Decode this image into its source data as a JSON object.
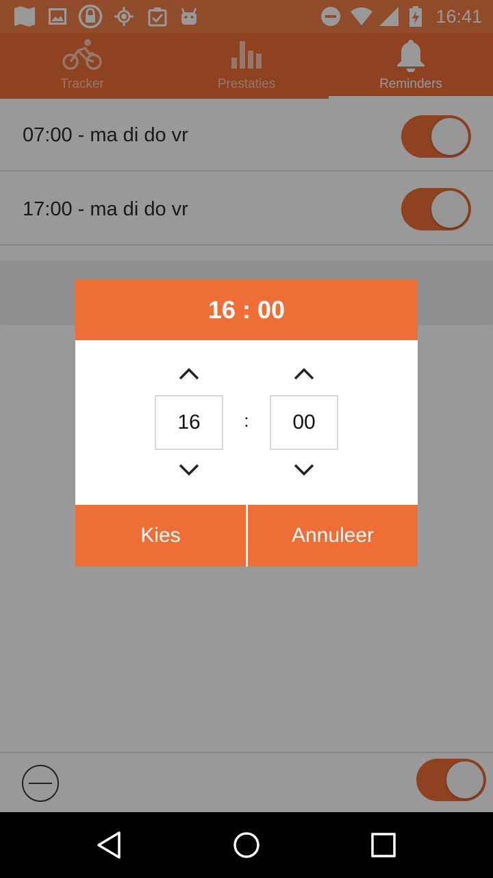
{
  "status_bar": {
    "time": "16:41",
    "icons_left": [
      "map-icon",
      "image-icon",
      "lock-icon",
      "location-icon",
      "clipboard-check-icon",
      "android-icon"
    ],
    "icons_right": [
      "do-not-disturb-icon",
      "wifi-icon",
      "signal-icon",
      "battery-charging-icon"
    ]
  },
  "tabs": [
    {
      "label": "Tracker",
      "icon": "bike-icon",
      "active": false
    },
    {
      "label": "Prestaties",
      "icon": "bar-chart-icon",
      "active": false
    },
    {
      "label": "Reminders",
      "icon": "bell-icon",
      "active": true
    }
  ],
  "reminders": [
    {
      "label": "07:00 - ma di do vr",
      "enabled": true
    },
    {
      "label": "17:00 - ma di do vr",
      "enabled": true
    }
  ],
  "bottom_bar": {
    "toggle_enabled": true
  },
  "dialog": {
    "title": "16 : 00",
    "hour": "16",
    "minute": "00",
    "separator": ":",
    "confirm_label": "Kies",
    "cancel_label": "Annuleer"
  },
  "colors": {
    "accent": "#ee6e36",
    "status_bar": "#f07d46"
  },
  "nav_bar": {
    "buttons": [
      "back-icon",
      "home-icon",
      "recents-icon"
    ]
  }
}
